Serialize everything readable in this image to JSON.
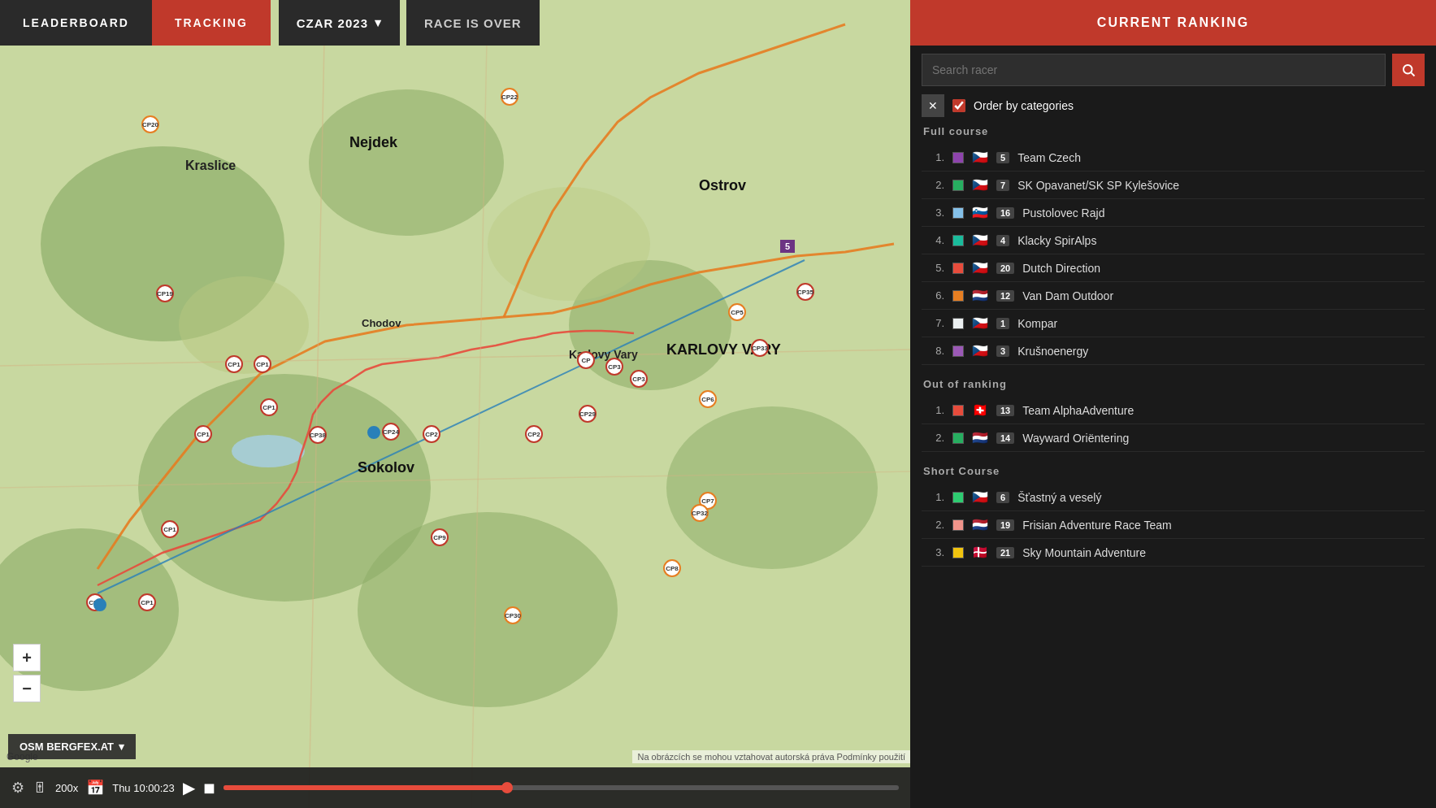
{
  "header": {
    "leaderboard_label": "LEADERBOARD",
    "tracking_label": "TRACKING",
    "czar_label": "CZAR 2023",
    "race_status_label": "RACE IS OVER",
    "panel_title": "CURRENT RANKING"
  },
  "map": {
    "base_provider": "OSM BERGFEX.AT",
    "zoom_in": "+",
    "zoom_out": "−",
    "google_label": "Google",
    "copyright": "Na obrázcích se mohou vztahovat autorská práva   Podmínky použití"
  },
  "playback": {
    "speed": "200x",
    "time": "Thu 10:00:23",
    "play_icon": "▶",
    "stop_icon": "◼",
    "progress_pct": 42
  },
  "search": {
    "placeholder": "Search racer",
    "search_icon": "🔍"
  },
  "filter": {
    "label": "Order by categories",
    "checked": true
  },
  "ranking": {
    "full_course": {
      "title": "Full course",
      "items": [
        {
          "rank": 1,
          "color": "#8e44ad",
          "flag": "🇨🇿",
          "bib": "5",
          "name": "Team Czech"
        },
        {
          "rank": 2,
          "color": "#27ae60",
          "flag": "🇨🇿",
          "bib": "7",
          "name": "SK Opavanet/SK SP Kylešovice"
        },
        {
          "rank": 3,
          "color": "#85c1e9",
          "flag": "🇸🇮",
          "bib": "16",
          "name": "Pustolovec Rajd"
        },
        {
          "rank": 4,
          "color": "#1abc9c",
          "flag": "🇨🇿",
          "bib": "4",
          "name": "Klacky SpirAlps"
        },
        {
          "rank": 5,
          "color": "#e74c3c",
          "flag": "🇨🇿",
          "bib": "20",
          "name": "Dutch Direction"
        },
        {
          "rank": 6,
          "color": "#e67e22",
          "flag": "🇳🇱",
          "bib": "12",
          "name": "Van Dam Outdoor"
        },
        {
          "rank": 7,
          "color": "#ecf0f1",
          "flag": "🇨🇿",
          "bib": "1",
          "name": "Kompar"
        },
        {
          "rank": 8,
          "color": "#9b59b6",
          "flag": "🇨🇿",
          "bib": "3",
          "name": "Krušnoenergy"
        }
      ]
    },
    "out_of_ranking": {
      "title": "Out of ranking",
      "items": [
        {
          "rank": 1,
          "color": "#e74c3c",
          "flag": "🇨🇭",
          "bib": "13",
          "name": "Team AlphaAdventure"
        },
        {
          "rank": 2,
          "color": "#27ae60",
          "flag": "🇳🇱",
          "bib": "14",
          "name": "Wayward Oriëntering"
        }
      ]
    },
    "short_course": {
      "title": "Short Course",
      "items": [
        {
          "rank": 1,
          "color": "#2ecc71",
          "flag": "🇨🇿",
          "bib": "6",
          "name": "Šťastný a veselý"
        },
        {
          "rank": 2,
          "color": "#f1948a",
          "flag": "🇳🇱",
          "bib": "19",
          "name": "Frisian Adventure Race Team"
        },
        {
          "rank": 3,
          "color": "#f1c40f",
          "flag": "🇩🇰",
          "bib": "21",
          "name": "Sky Mountain Adventure"
        }
      ]
    }
  },
  "map_places": [
    {
      "name": "Nejdek",
      "size": "big"
    },
    {
      "name": "Karlovy Vary",
      "size": "big"
    },
    {
      "name": "Sokolov",
      "size": "big"
    },
    {
      "name": "Chodov",
      "size": "med"
    },
    {
      "name": "Ostrov",
      "size": "big"
    }
  ]
}
